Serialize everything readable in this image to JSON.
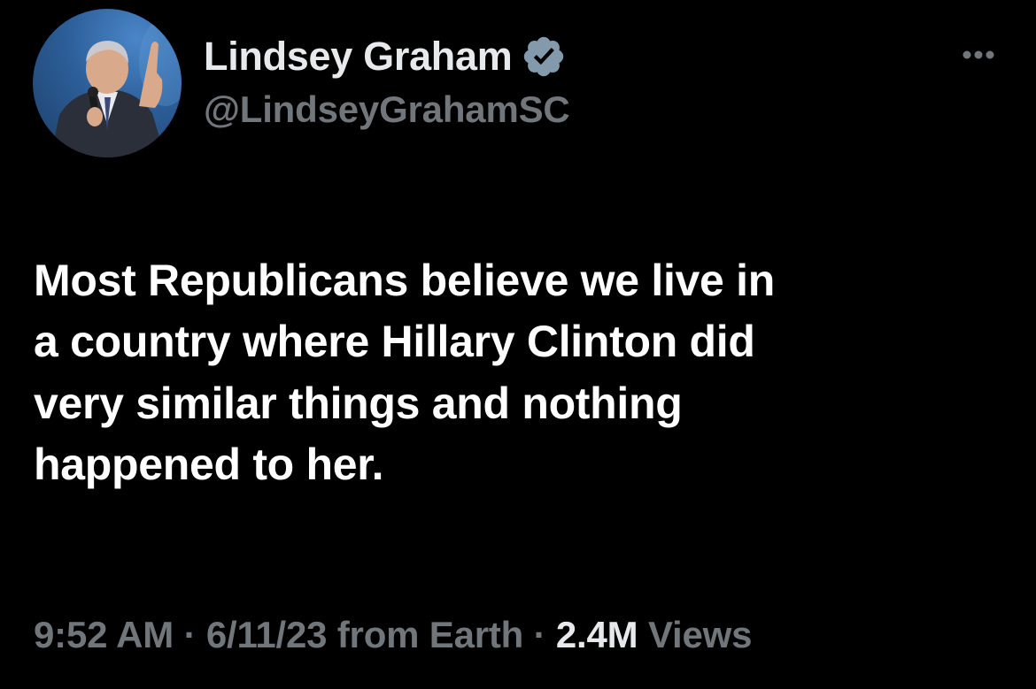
{
  "author": {
    "display_name": "Lindsey Graham",
    "handle": "@LindseyGrahamSC",
    "verified": true
  },
  "tweet": {
    "lines": [
      "Most Republicans believe we live in",
      "a country where Hillary Clinton did",
      "very similar things and nothing",
      "happened to her."
    ]
  },
  "meta": {
    "time": "9:52 AM",
    "sep1": "·",
    "date": "6/11/23",
    "source": "from Earth",
    "sep2": "·",
    "views_count": "2.4M",
    "views_label": "Views"
  },
  "icons": {
    "verified": "verified-badge-icon",
    "more": "more-options-icon"
  },
  "colors": {
    "background": "#000000",
    "primary_text": "#e7e9ea",
    "secondary_text": "#71767b",
    "avatar_bg": "#2c5e98"
  }
}
